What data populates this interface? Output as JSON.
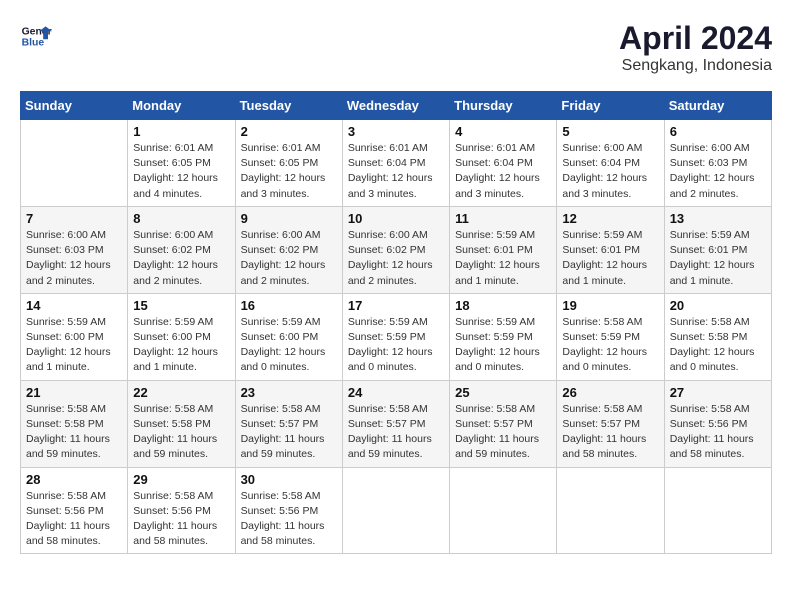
{
  "header": {
    "logo_line1": "General",
    "logo_line2": "Blue",
    "month_year": "April 2024",
    "location": "Sengkang, Indonesia"
  },
  "days_of_week": [
    "Sunday",
    "Monday",
    "Tuesday",
    "Wednesday",
    "Thursday",
    "Friday",
    "Saturday"
  ],
  "weeks": [
    [
      {
        "day": "",
        "info": ""
      },
      {
        "day": "1",
        "info": "Sunrise: 6:01 AM\nSunset: 6:05 PM\nDaylight: 12 hours\nand 4 minutes."
      },
      {
        "day": "2",
        "info": "Sunrise: 6:01 AM\nSunset: 6:05 PM\nDaylight: 12 hours\nand 3 minutes."
      },
      {
        "day": "3",
        "info": "Sunrise: 6:01 AM\nSunset: 6:04 PM\nDaylight: 12 hours\nand 3 minutes."
      },
      {
        "day": "4",
        "info": "Sunrise: 6:01 AM\nSunset: 6:04 PM\nDaylight: 12 hours\nand 3 minutes."
      },
      {
        "day": "5",
        "info": "Sunrise: 6:00 AM\nSunset: 6:04 PM\nDaylight: 12 hours\nand 3 minutes."
      },
      {
        "day": "6",
        "info": "Sunrise: 6:00 AM\nSunset: 6:03 PM\nDaylight: 12 hours\nand 2 minutes."
      }
    ],
    [
      {
        "day": "7",
        "info": "Sunrise: 6:00 AM\nSunset: 6:03 PM\nDaylight: 12 hours\nand 2 minutes."
      },
      {
        "day": "8",
        "info": "Sunrise: 6:00 AM\nSunset: 6:02 PM\nDaylight: 12 hours\nand 2 minutes."
      },
      {
        "day": "9",
        "info": "Sunrise: 6:00 AM\nSunset: 6:02 PM\nDaylight: 12 hours\nand 2 minutes."
      },
      {
        "day": "10",
        "info": "Sunrise: 6:00 AM\nSunset: 6:02 PM\nDaylight: 12 hours\nand 2 minutes."
      },
      {
        "day": "11",
        "info": "Sunrise: 5:59 AM\nSunset: 6:01 PM\nDaylight: 12 hours\nand 1 minute."
      },
      {
        "day": "12",
        "info": "Sunrise: 5:59 AM\nSunset: 6:01 PM\nDaylight: 12 hours\nand 1 minute."
      },
      {
        "day": "13",
        "info": "Sunrise: 5:59 AM\nSunset: 6:01 PM\nDaylight: 12 hours\nand 1 minute."
      }
    ],
    [
      {
        "day": "14",
        "info": "Sunrise: 5:59 AM\nSunset: 6:00 PM\nDaylight: 12 hours\nand 1 minute."
      },
      {
        "day": "15",
        "info": "Sunrise: 5:59 AM\nSunset: 6:00 PM\nDaylight: 12 hours\nand 1 minute."
      },
      {
        "day": "16",
        "info": "Sunrise: 5:59 AM\nSunset: 6:00 PM\nDaylight: 12 hours\nand 0 minutes."
      },
      {
        "day": "17",
        "info": "Sunrise: 5:59 AM\nSunset: 5:59 PM\nDaylight: 12 hours\nand 0 minutes."
      },
      {
        "day": "18",
        "info": "Sunrise: 5:59 AM\nSunset: 5:59 PM\nDaylight: 12 hours\nand 0 minutes."
      },
      {
        "day": "19",
        "info": "Sunrise: 5:58 AM\nSunset: 5:59 PM\nDaylight: 12 hours\nand 0 minutes."
      },
      {
        "day": "20",
        "info": "Sunrise: 5:58 AM\nSunset: 5:58 PM\nDaylight: 12 hours\nand 0 minutes."
      }
    ],
    [
      {
        "day": "21",
        "info": "Sunrise: 5:58 AM\nSunset: 5:58 PM\nDaylight: 11 hours\nand 59 minutes."
      },
      {
        "day": "22",
        "info": "Sunrise: 5:58 AM\nSunset: 5:58 PM\nDaylight: 11 hours\nand 59 minutes."
      },
      {
        "day": "23",
        "info": "Sunrise: 5:58 AM\nSunset: 5:57 PM\nDaylight: 11 hours\nand 59 minutes."
      },
      {
        "day": "24",
        "info": "Sunrise: 5:58 AM\nSunset: 5:57 PM\nDaylight: 11 hours\nand 59 minutes."
      },
      {
        "day": "25",
        "info": "Sunrise: 5:58 AM\nSunset: 5:57 PM\nDaylight: 11 hours\nand 59 minutes."
      },
      {
        "day": "26",
        "info": "Sunrise: 5:58 AM\nSunset: 5:57 PM\nDaylight: 11 hours\nand 58 minutes."
      },
      {
        "day": "27",
        "info": "Sunrise: 5:58 AM\nSunset: 5:56 PM\nDaylight: 11 hours\nand 58 minutes."
      }
    ],
    [
      {
        "day": "28",
        "info": "Sunrise: 5:58 AM\nSunset: 5:56 PM\nDaylight: 11 hours\nand 58 minutes."
      },
      {
        "day": "29",
        "info": "Sunrise: 5:58 AM\nSunset: 5:56 PM\nDaylight: 11 hours\nand 58 minutes."
      },
      {
        "day": "30",
        "info": "Sunrise: 5:58 AM\nSunset: 5:56 PM\nDaylight: 11 hours\nand 58 minutes."
      },
      {
        "day": "",
        "info": ""
      },
      {
        "day": "",
        "info": ""
      },
      {
        "day": "",
        "info": ""
      },
      {
        "day": "",
        "info": ""
      }
    ]
  ]
}
